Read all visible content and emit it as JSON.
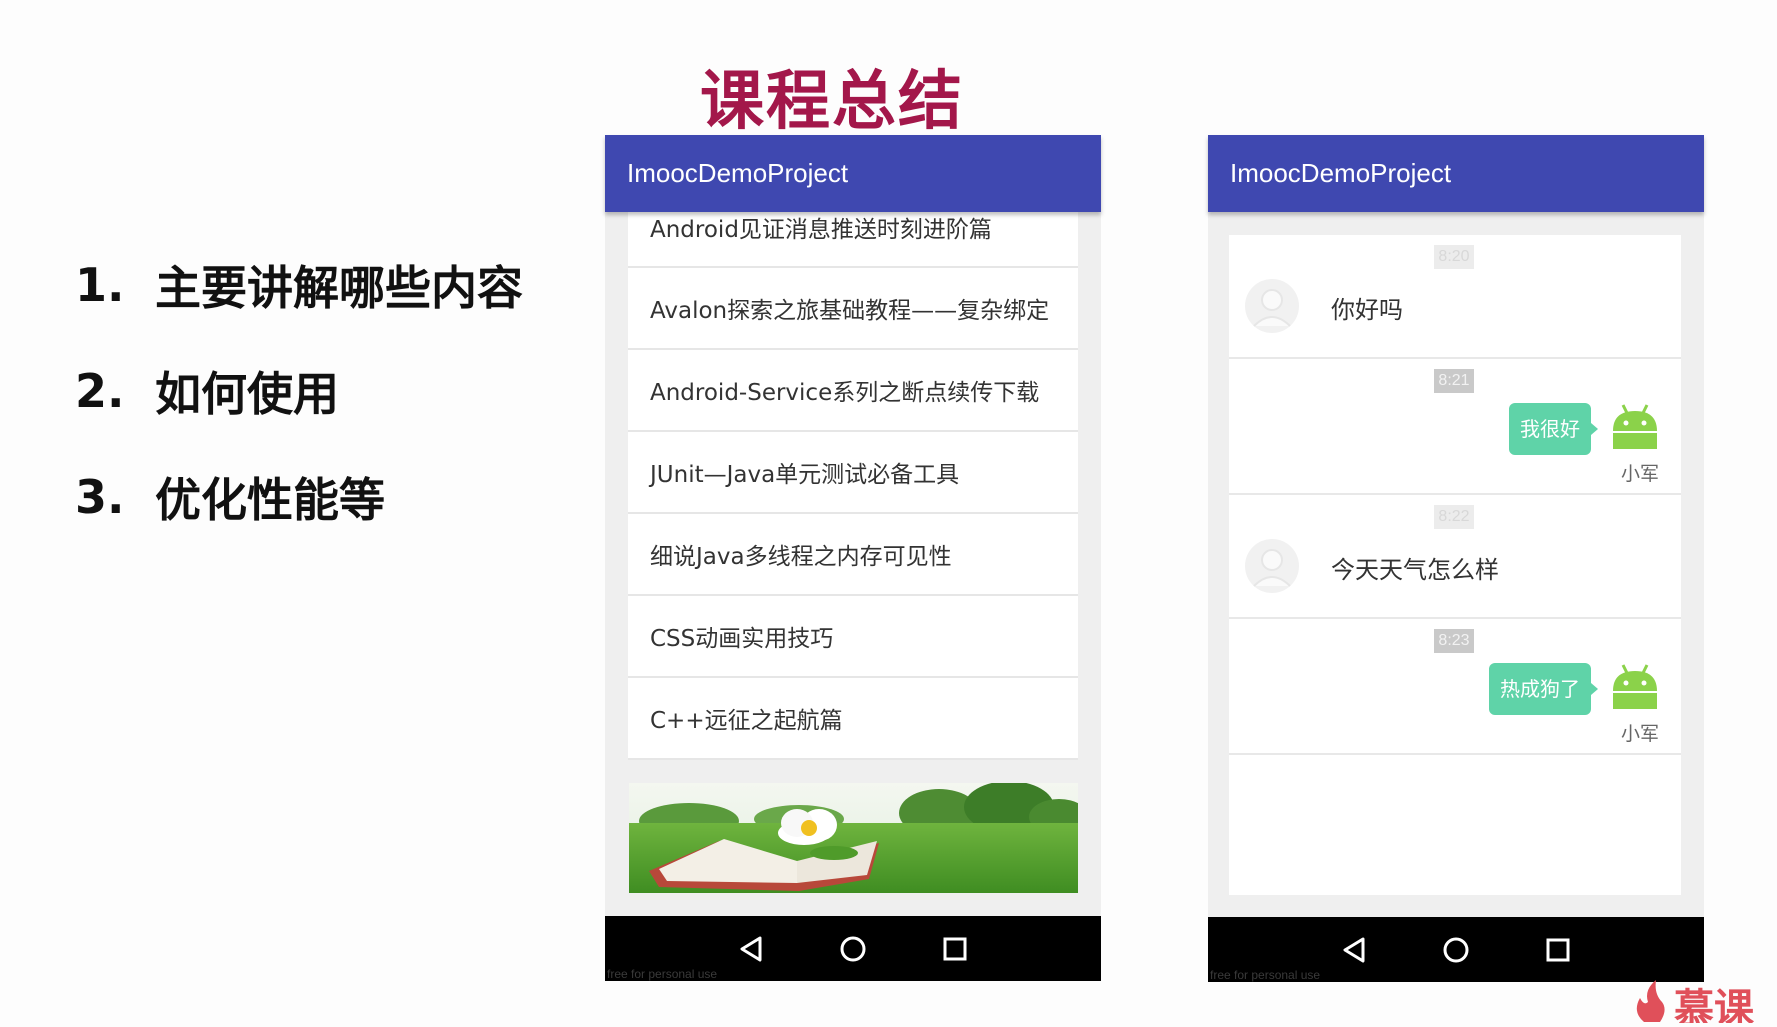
{
  "slide_title": "课程总结",
  "outline": [
    {
      "num": "1.",
      "text": "主要讲解哪些内容"
    },
    {
      "num": "2.",
      "text": "如何使用"
    },
    {
      "num": "3.",
      "text": "优化性能等"
    }
  ],
  "phone_left": {
    "app_title": "ImoocDemoProject",
    "items": [
      "Android见证消息推送时刻进阶篇",
      "Avalon探索之旅基础教程——复杂绑定",
      "Android-Service系列之断点续传下载",
      "JUnit—Java单元测试必备工具",
      "细说Java多线程之内存可见性",
      "CSS动画实用技巧",
      "C++远征之起航篇"
    ],
    "watermark": "free for personal use"
  },
  "phone_right": {
    "app_title": "ImoocDemoProject",
    "messages": [
      {
        "time": "8:20",
        "text": "你好吗"
      },
      {
        "time": "8:21",
        "text": "我很好",
        "nick": "小军"
      },
      {
        "time": "8:22",
        "text": "今天天气怎么样"
      },
      {
        "time": "8:23",
        "text": "热成狗了",
        "nick": "小军"
      }
    ],
    "watermark": "free for personal use"
  },
  "corner_brand": "慕课",
  "colors": {
    "app_bar": "#3f48b0",
    "title_accent": "#a3174a",
    "bubble": "#5fd3a8",
    "android_green": "#8bd24a"
  },
  "icons": [
    "back-triangle-icon",
    "home-circle-icon",
    "recents-square-icon",
    "android-robot-icon",
    "default-avatar-icon",
    "flame-icon"
  ]
}
